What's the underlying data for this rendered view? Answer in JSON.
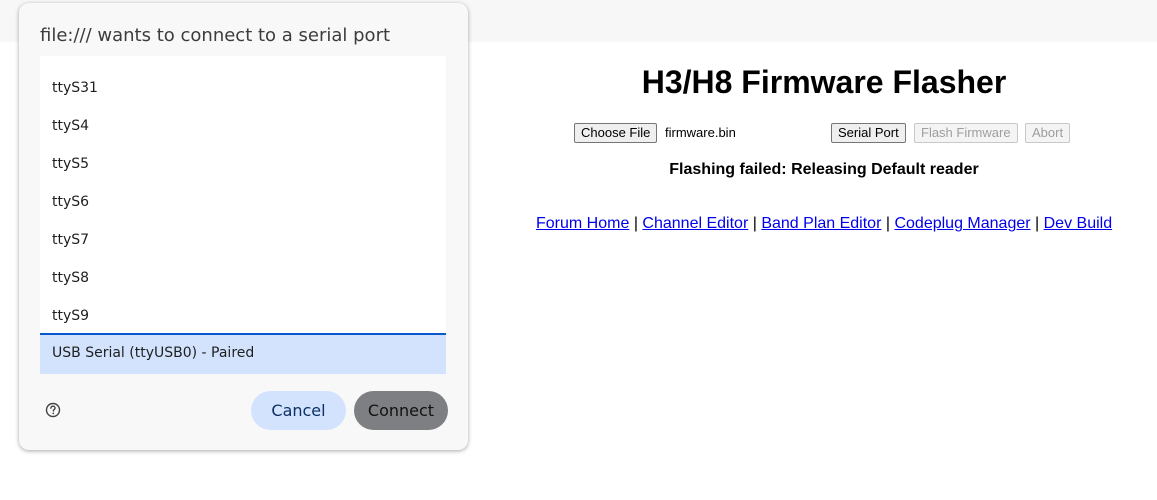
{
  "page": {
    "title": "H3/H8 Firmware Flasher",
    "choose_file_label": "Choose File",
    "file_name": "firmware.bin",
    "serial_port_label": "Serial Port",
    "flash_firmware_label": "Flash Firmware",
    "abort_label": "Abort",
    "status_text": "Flashing failed: Releasing Default reader",
    "links": [
      {
        "label": "Forum Home"
      },
      {
        "label": "Channel Editor"
      },
      {
        "label": "Band Plan Editor"
      },
      {
        "label": "Codeplug Manager"
      },
      {
        "label": "Dev Build"
      }
    ],
    "link_separator": "|"
  },
  "dialog": {
    "title": "file:/// wants to connect to a serial port",
    "ports": [
      {
        "label": "ttyS31"
      },
      {
        "label": "ttyS4"
      },
      {
        "label": "ttyS5"
      },
      {
        "label": "ttyS6"
      },
      {
        "label": "ttyS7"
      },
      {
        "label": "ttyS8"
      },
      {
        "label": "ttyS9"
      },
      {
        "label": "USB Serial (ttyUSB0) - Paired",
        "selected": true
      }
    ],
    "help_icon": "question-circle-icon",
    "cancel_label": "Cancel",
    "connect_label": "Connect"
  },
  "colors": {
    "link": "#0000ee",
    "selected_row": "#d3e3fd",
    "selected_border": "#0b57d0",
    "cancel_bg": "#d3e3fd",
    "connect_bg": "#7d7f82"
  }
}
